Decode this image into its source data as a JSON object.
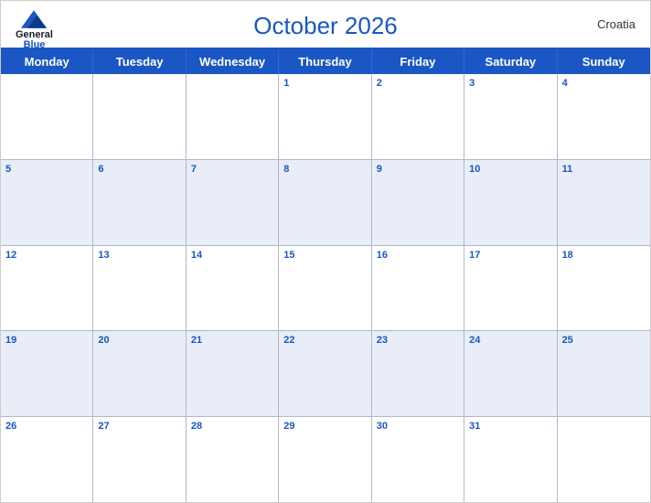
{
  "header": {
    "logo": {
      "general": "General",
      "blue": "Blue"
    },
    "title": "October 2026",
    "country": "Croatia"
  },
  "dayHeaders": [
    "Monday",
    "Tuesday",
    "Wednesday",
    "Thursday",
    "Friday",
    "Saturday",
    "Sunday"
  ],
  "weeks": [
    {
      "shaded": false,
      "days": [
        {
          "date": "",
          "inMonth": false
        },
        {
          "date": "",
          "inMonth": false
        },
        {
          "date": "",
          "inMonth": false
        },
        {
          "date": "1",
          "inMonth": true
        },
        {
          "date": "2",
          "inMonth": true
        },
        {
          "date": "3",
          "inMonth": true
        },
        {
          "date": "4",
          "inMonth": true
        }
      ]
    },
    {
      "shaded": true,
      "days": [
        {
          "date": "5",
          "inMonth": true
        },
        {
          "date": "6",
          "inMonth": true
        },
        {
          "date": "7",
          "inMonth": true
        },
        {
          "date": "8",
          "inMonth": true
        },
        {
          "date": "9",
          "inMonth": true
        },
        {
          "date": "10",
          "inMonth": true
        },
        {
          "date": "11",
          "inMonth": true
        }
      ]
    },
    {
      "shaded": false,
      "days": [
        {
          "date": "12",
          "inMonth": true
        },
        {
          "date": "13",
          "inMonth": true
        },
        {
          "date": "14",
          "inMonth": true
        },
        {
          "date": "15",
          "inMonth": true
        },
        {
          "date": "16",
          "inMonth": true
        },
        {
          "date": "17",
          "inMonth": true
        },
        {
          "date": "18",
          "inMonth": true
        }
      ]
    },
    {
      "shaded": true,
      "days": [
        {
          "date": "19",
          "inMonth": true
        },
        {
          "date": "20",
          "inMonth": true
        },
        {
          "date": "21",
          "inMonth": true
        },
        {
          "date": "22",
          "inMonth": true
        },
        {
          "date": "23",
          "inMonth": true
        },
        {
          "date": "24",
          "inMonth": true
        },
        {
          "date": "25",
          "inMonth": true
        }
      ]
    },
    {
      "shaded": false,
      "days": [
        {
          "date": "26",
          "inMonth": true
        },
        {
          "date": "27",
          "inMonth": true
        },
        {
          "date": "28",
          "inMonth": true
        },
        {
          "date": "29",
          "inMonth": true
        },
        {
          "date": "30",
          "inMonth": true
        },
        {
          "date": "31",
          "inMonth": true
        },
        {
          "date": "",
          "inMonth": false
        }
      ]
    }
  ],
  "colors": {
    "accent": "#1a56c4",
    "headerBg": "#1a56c4",
    "shadedRow": "#e8edf7",
    "border": "#b0b8cc"
  }
}
